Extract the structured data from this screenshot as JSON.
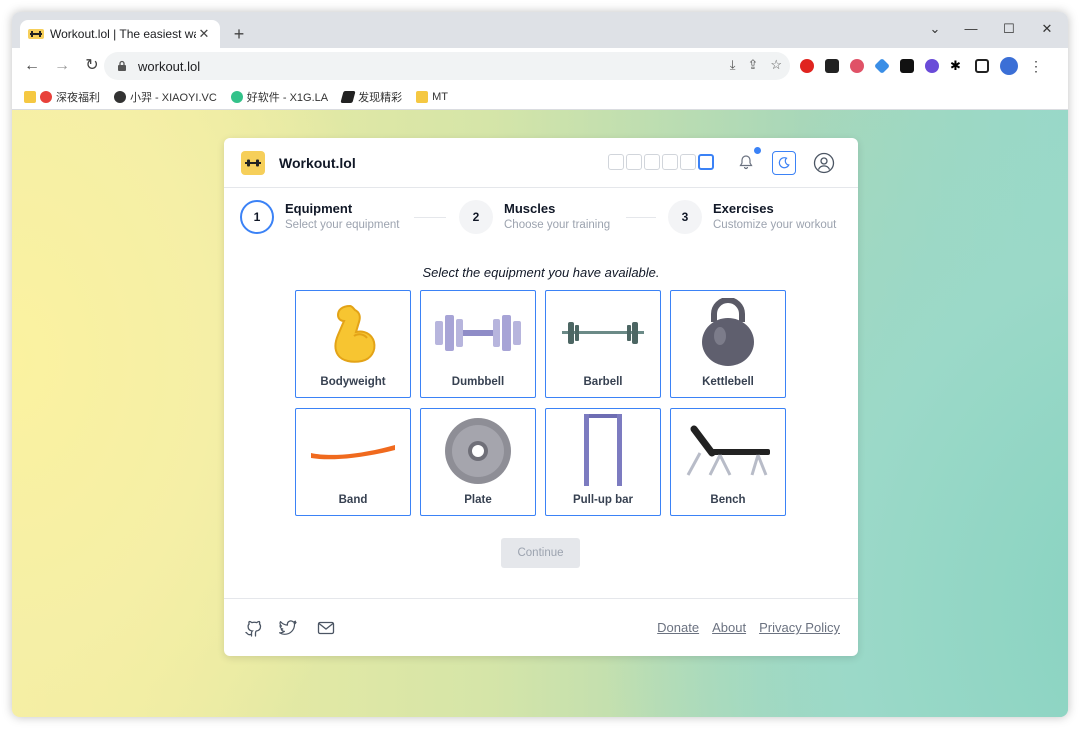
{
  "browser": {
    "tab_title": "Workout.lol | The easiest way to",
    "url": "workout.lol",
    "bookmarks": [
      "深夜福利",
      "小羿 - XIAOYI.VC",
      "好软件 - X1G.LA",
      "发现精彩",
      "MT"
    ]
  },
  "app": {
    "brand": "Workout.lol",
    "accent": "#3b82f6",
    "steps": [
      {
        "num": "1",
        "title": "Equipment",
        "subtitle": "Select your equipment"
      },
      {
        "num": "2",
        "title": "Muscles",
        "subtitle": "Choose your training"
      },
      {
        "num": "3",
        "title": "Exercises",
        "subtitle": "Customize your workout"
      }
    ],
    "instruction": "Select the equipment you have available.",
    "equipment": [
      {
        "label": "Bodyweight"
      },
      {
        "label": "Dumbbell"
      },
      {
        "label": "Barbell"
      },
      {
        "label": "Kettlebell"
      },
      {
        "label": "Band"
      },
      {
        "label": "Plate"
      },
      {
        "label": "Pull-up bar"
      },
      {
        "label": "Bench"
      }
    ],
    "continue_label": "Continue",
    "footer_links": [
      "Donate",
      "About",
      "Privacy Policy"
    ]
  }
}
